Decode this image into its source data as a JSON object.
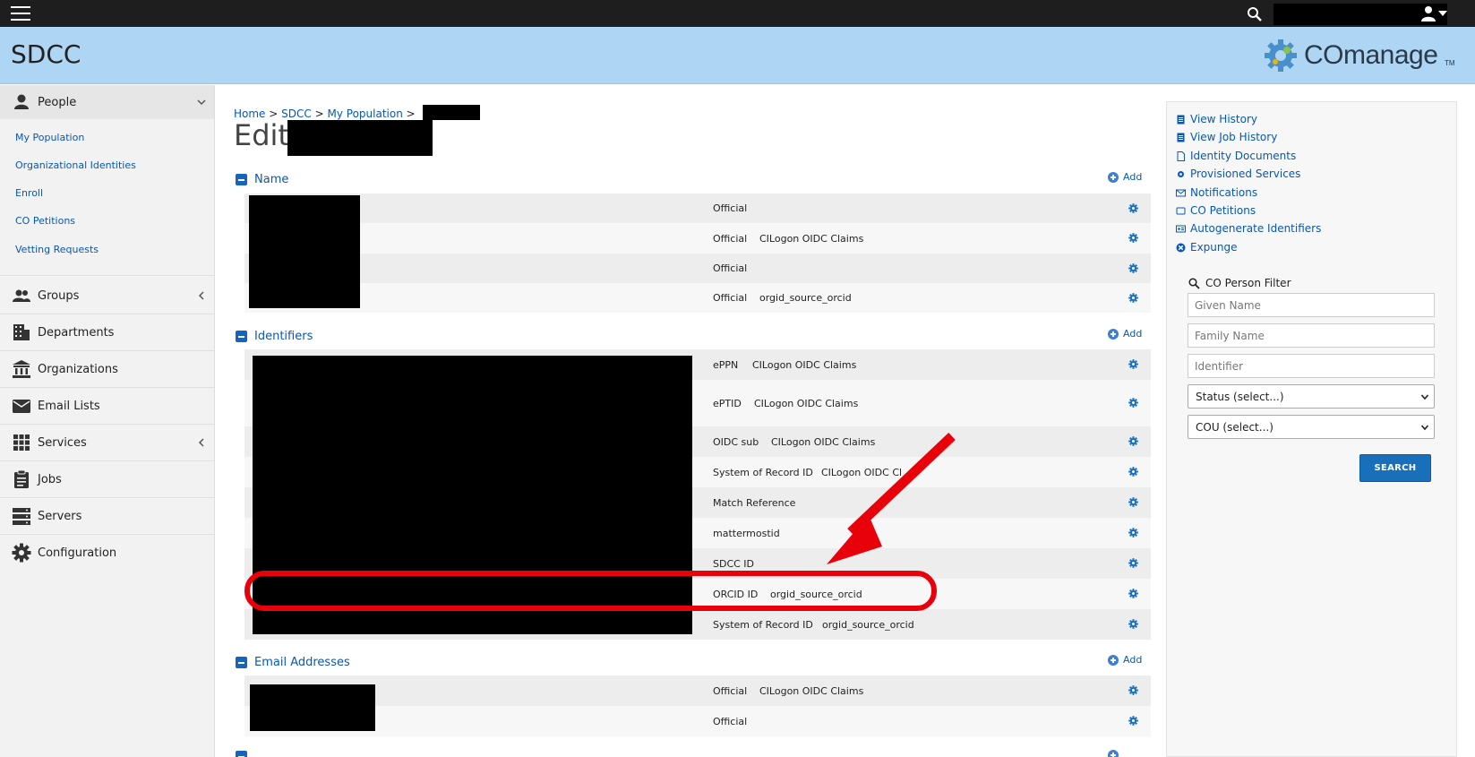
{
  "header": {
    "site_title": "SDCC",
    "logo_text": "COmanage",
    "logo_tm": "TM"
  },
  "sidebar": {
    "people": {
      "label": "People",
      "items": [
        "My Population",
        "Organizational Identities",
        "Enroll",
        "CO Petitions",
        "Vetting Requests"
      ]
    },
    "sections": [
      "Groups",
      "Departments",
      "Organizations",
      "Email Lists",
      "Services",
      "Jobs",
      "Servers",
      "Configuration"
    ]
  },
  "breadcrumb": {
    "home": "Home",
    "sep": ">",
    "sdcc": "SDCC",
    "population": "My Population"
  },
  "page_title": "Edit",
  "name_section": {
    "label": "Name",
    "add": "Add",
    "rows": [
      {
        "type": "Official",
        "source": ""
      },
      {
        "type": "Official",
        "source": "CILogon OIDC Claims"
      },
      {
        "type": "Official",
        "source": ""
      },
      {
        "type": "Official",
        "source": "orgid_source_orcid"
      }
    ]
  },
  "identifiers_section": {
    "label": "Identifiers",
    "add": "Add",
    "rows": [
      {
        "type": "ePPN",
        "source": "CILogon OIDC Claims"
      },
      {
        "type": "ePTID",
        "source": "CILogon OIDC Claims"
      },
      {
        "type": "OIDC sub",
        "source": "CILogon OIDC Claims"
      },
      {
        "type": "System of Record ID",
        "source": "CILogon OIDC Cl"
      },
      {
        "type": "Match Reference",
        "source": ""
      },
      {
        "type": "mattermostid",
        "source": ""
      },
      {
        "type": "SDCC ID",
        "source": ""
      },
      {
        "type": "ORCID ID",
        "source": "orgid_source_orcid"
      },
      {
        "type": "System of Record ID",
        "source": "orgid_source_orcid"
      }
    ]
  },
  "email_section": {
    "label": "Email Addresses",
    "add": "Add",
    "rows": [
      {
        "type": "Official",
        "source": "CILogon OIDC Claims"
      },
      {
        "type": "Official",
        "source": ""
      }
    ]
  },
  "right_panel": {
    "links": [
      "View History",
      "View Job History",
      "Identity Documents",
      "Provisioned Services",
      "Notifications",
      "CO Petitions",
      "Autogenerate Identifiers",
      "Expunge"
    ],
    "filter_title": "CO Person Filter",
    "given_name_placeholder": "Given Name",
    "family_name_placeholder": "Family Name",
    "identifier_placeholder": "Identifier",
    "status_select": "Status (select...)",
    "cou_select": "COU (select...)",
    "search_button": "SEARCH"
  },
  "colors": {
    "header_bg": "#aed5f4",
    "link": "#0a57b1",
    "annotation": "#e8000b",
    "button": "#1a6fbb"
  }
}
